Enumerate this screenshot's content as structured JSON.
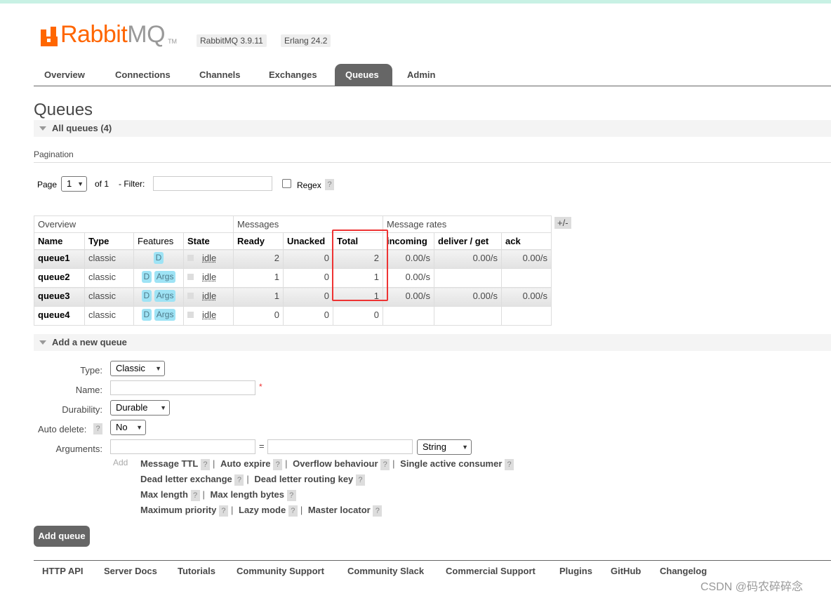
{
  "header": {
    "logo_primary": "Rabbit",
    "logo_secondary": "MQ",
    "logo_tm": "TM",
    "rabbitmq_version": "RabbitMQ 3.9.11",
    "erlang_version": "Erlang 24.2"
  },
  "tabs": [
    "Overview",
    "Connections",
    "Channels",
    "Exchanges",
    "Queues",
    "Admin"
  ],
  "active_tab": "Queues",
  "page_title": "Queues",
  "all_queues_label": "All queues (4)",
  "pagination": {
    "label": "Pagination",
    "page_label": "Page",
    "page_value": "1",
    "of_label": "of 1",
    "filter_label": "- Filter:",
    "filter_value": "",
    "regex_label": "Regex",
    "regex_checked": false,
    "help": "?"
  },
  "table": {
    "group_headers": [
      "Overview",
      "Messages",
      "Message rates"
    ],
    "toggle": "+/-",
    "columns": [
      "Name",
      "Type",
      "Features",
      "State",
      "Ready",
      "Unacked",
      "Total",
      "incoming",
      "deliver / get",
      "ack"
    ],
    "rows": [
      {
        "name": "queue1",
        "type": "classic",
        "features": [
          "D"
        ],
        "state": "idle",
        "ready": "2",
        "unacked": "0",
        "total": "2",
        "incoming": "0.00/s",
        "deliver_get": "0.00/s",
        "ack": "0.00/s"
      },
      {
        "name": "queue2",
        "type": "classic",
        "features": [
          "D",
          "Args"
        ],
        "state": "idle",
        "ready": "1",
        "unacked": "0",
        "total": "1",
        "incoming": "0.00/s",
        "deliver_get": "",
        "ack": ""
      },
      {
        "name": "queue3",
        "type": "classic",
        "features": [
          "D",
          "Args"
        ],
        "state": "idle",
        "ready": "1",
        "unacked": "0",
        "total": "1",
        "incoming": "0.00/s",
        "deliver_get": "0.00/s",
        "ack": "0.00/s"
      },
      {
        "name": "queue4",
        "type": "classic",
        "features": [
          "D",
          "Args"
        ],
        "state": "idle",
        "ready": "0",
        "unacked": "0",
        "total": "0",
        "incoming": "",
        "deliver_get": "",
        "ack": ""
      }
    ]
  },
  "add_queue": {
    "section_label": "Add a new queue",
    "type_label": "Type:",
    "type_value": "Classic",
    "name_label": "Name:",
    "name_value": "",
    "required_mark": "*",
    "durability_label": "Durability:",
    "durability_value": "Durable",
    "auto_delete_label": "Auto delete:",
    "auto_delete_value": "No",
    "arguments_label": "Arguments:",
    "equals": "=",
    "arg_type_value": "String",
    "add_label": "Add",
    "arg_rows": [
      [
        "Message TTL",
        "Auto expire",
        "Overflow behaviour",
        "Single active consumer"
      ],
      [
        "Dead letter exchange",
        "Dead letter routing key"
      ],
      [
        "Max length",
        "Max length bytes"
      ],
      [
        "Maximum priority",
        "Lazy mode",
        "Master locator"
      ]
    ],
    "button_label": "Add queue"
  },
  "footer": [
    "HTTP API",
    "Server Docs",
    "Tutorials",
    "Community Support",
    "Community Slack",
    "Commercial Support",
    "Plugins",
    "GitHub",
    "Changelog"
  ],
  "watermark": "CSDN @码农碎碎念",
  "colors": {
    "brand": "#ff6600",
    "tab_active": "#666666",
    "feature_pill": "#9ee3f5",
    "highlight": "#ee3333"
  }
}
